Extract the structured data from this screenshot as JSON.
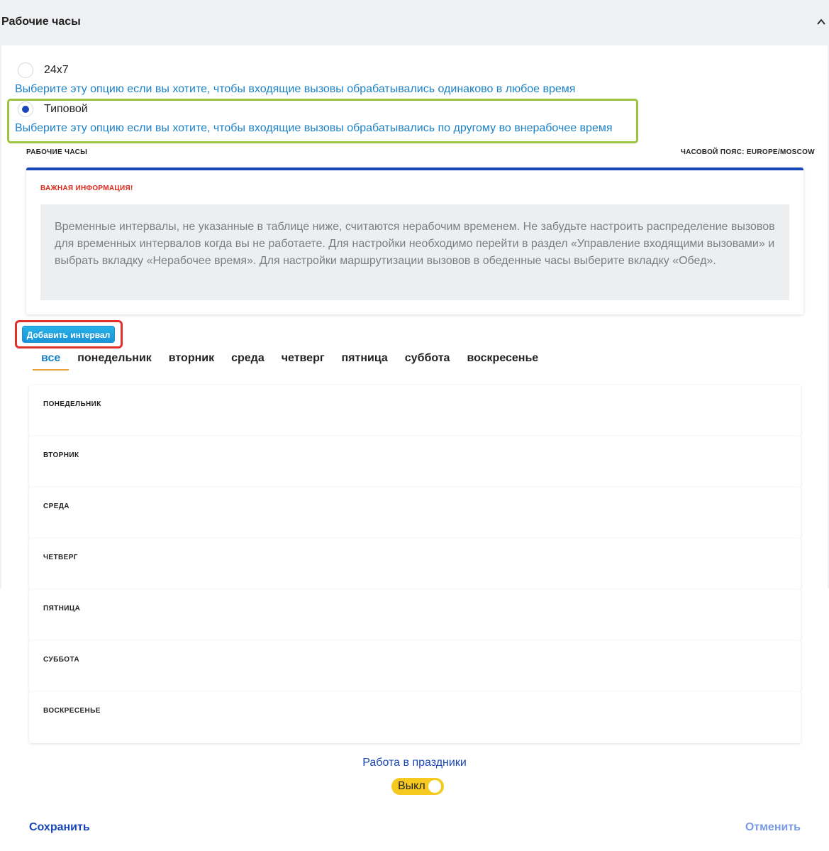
{
  "header": {
    "title": "Рабочие часы",
    "collapse_icon": "chevron-up-icon"
  },
  "mode": {
    "option_247": {
      "label": "24х7",
      "hint": "Выберите эту опцию если вы хотите, чтобы входящие вызовы обрабатывались одинаково в любое время",
      "selected": false
    },
    "option_typical": {
      "label": "Типовой",
      "hint": "Выберите эту опцию если вы хотите, чтобы входящие вызовы обрабатывались по другому во внерабочее время",
      "selected": true
    }
  },
  "schedule": {
    "title": "РАБОЧИЕ ЧАСЫ",
    "timezone": "ЧАСОВОЙ ПОЯС: EUROPE/MOSCOW"
  },
  "info": {
    "title": "ВАЖНАЯ ИНФОРМАЦИЯ!",
    "text": "Временные интервалы, не указанные в таблице ниже, считаются нерабочим временем. Не забудьте настроить распределение вызовов для временных интервалов когда вы не работаете. Для настройки необходимо перейти в раздел «Управление входящими вызовами» и выбрать вкладку «Нерабочее время». Для настройки маршрутизации вызовов в обеденные часы выберите вкладку «Обед»."
  },
  "add_interval_label": "Добавить интервал",
  "tabs": [
    {
      "label": "все",
      "active": true
    },
    {
      "label": "понедельник",
      "active": false
    },
    {
      "label": "вторник",
      "active": false
    },
    {
      "label": "среда",
      "active": false
    },
    {
      "label": "четверг",
      "active": false
    },
    {
      "label": "пятница",
      "active": false
    },
    {
      "label": "суббота",
      "active": false
    },
    {
      "label": "воскресенье",
      "active": false
    }
  ],
  "days": [
    {
      "label": "ПОНЕДЕЛЬНИК"
    },
    {
      "label": "ВТОРНИК"
    },
    {
      "label": "СРЕДА"
    },
    {
      "label": "ЧЕТВЕРГ"
    },
    {
      "label": "ПЯТНИЦА"
    },
    {
      "label": "СУББОТА"
    },
    {
      "label": "ВОСКРЕСЕНЬЕ"
    }
  ],
  "holidays": {
    "label": "Работа в праздники",
    "toggle_text": "Выкл",
    "enabled": false
  },
  "actions": {
    "save_label": "Сохранить",
    "cancel_label": "Отменить"
  },
  "colors": {
    "accent_blue": "#1a47b8",
    "hint_blue": "#1d82c8",
    "warning_red": "#e0271a",
    "highlight_green": "#9dc43d",
    "highlight_red": "#e0302a",
    "toggle_yellow": "#f6c921"
  }
}
